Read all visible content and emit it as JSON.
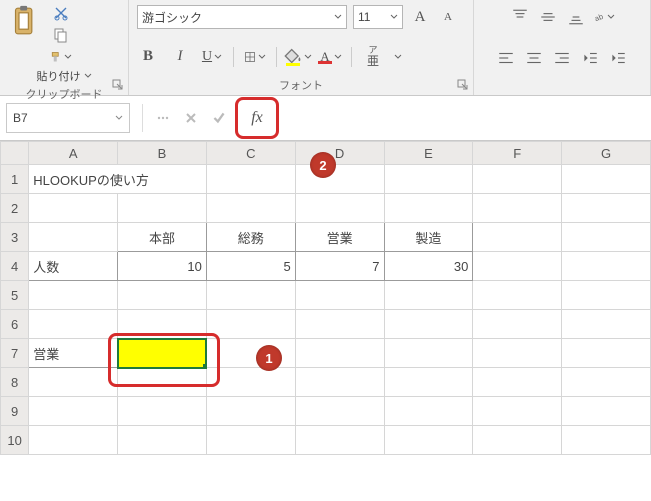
{
  "ribbon": {
    "clipboard": {
      "paste_label": "貼り付け",
      "group_label": "クリップボード"
    },
    "font": {
      "group_label": "フォント",
      "name": "游ゴシック",
      "size": "11",
      "bold": "B",
      "italic": "I",
      "underline": "U",
      "ruby_top": "ア",
      "ruby_bot": "亜",
      "inc": "A",
      "dec": "A",
      "fill_color": "#ffff00",
      "font_color": "#d33",
      "font_A": "A"
    }
  },
  "formula_bar": {
    "name_box": "B7",
    "fx": "fx",
    "formula": ""
  },
  "columns": [
    "A",
    "B",
    "C",
    "D",
    "E",
    "F",
    "G"
  ],
  "rows": [
    "1",
    "2",
    "3",
    "4",
    "5",
    "6",
    "7",
    "8",
    "9",
    "10"
  ],
  "cells": {
    "A1": "HLOOKUPの使い方",
    "B3": "本部",
    "C3": "総務",
    "D3": "営業",
    "E3": "製造",
    "A4": "人数",
    "B4": "10",
    "C4": "5",
    "D4": "7",
    "E4": "30",
    "A7": "営業"
  },
  "annotations": {
    "badge1": "1",
    "badge2": "2"
  },
  "chart_data": {
    "type": "table",
    "title": "HLOOKUPの使い方",
    "categories": [
      "本部",
      "総務",
      "営業",
      "製造"
    ],
    "series": [
      {
        "name": "人数",
        "values": [
          10,
          5,
          7,
          30
        ]
      }
    ],
    "lookup_key_cell": "営業",
    "selected_cell": "B7"
  }
}
